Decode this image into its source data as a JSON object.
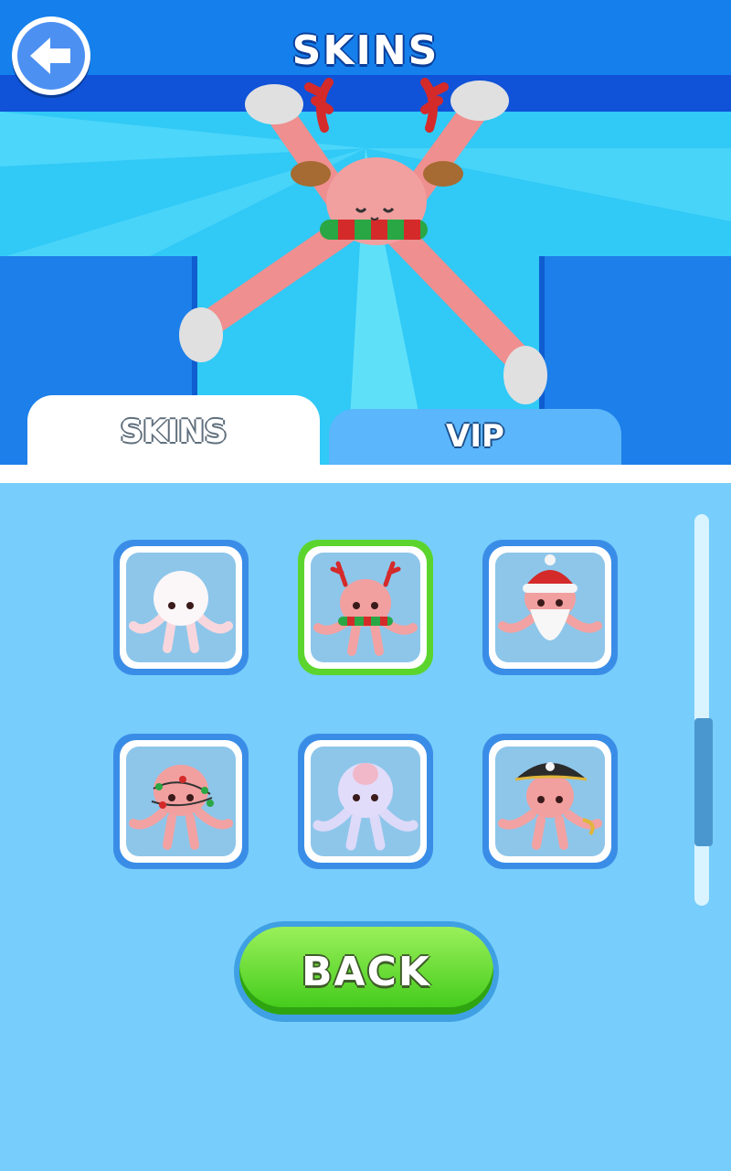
{
  "header": {
    "title": "SKINS"
  },
  "tabs": [
    {
      "label": "SKINS",
      "active": true
    },
    {
      "label": "VIP",
      "active": false
    }
  ],
  "skins": [
    {
      "name": "white-octopus-skin",
      "selected": false
    },
    {
      "name": "reindeer-octopus-skin",
      "selected": true
    },
    {
      "name": "santa-octopus-skin",
      "selected": false
    },
    {
      "name": "christmas-lights-octopus-skin",
      "selected": false
    },
    {
      "name": "galaxy-octopus-skin",
      "selected": false
    },
    {
      "name": "pirate-octopus-skin",
      "selected": false
    }
  ],
  "back_button": {
    "label": "BACK"
  },
  "colors": {
    "accent": "#5bd52e",
    "primary": "#1f8ff0",
    "button": "#3ec918"
  }
}
